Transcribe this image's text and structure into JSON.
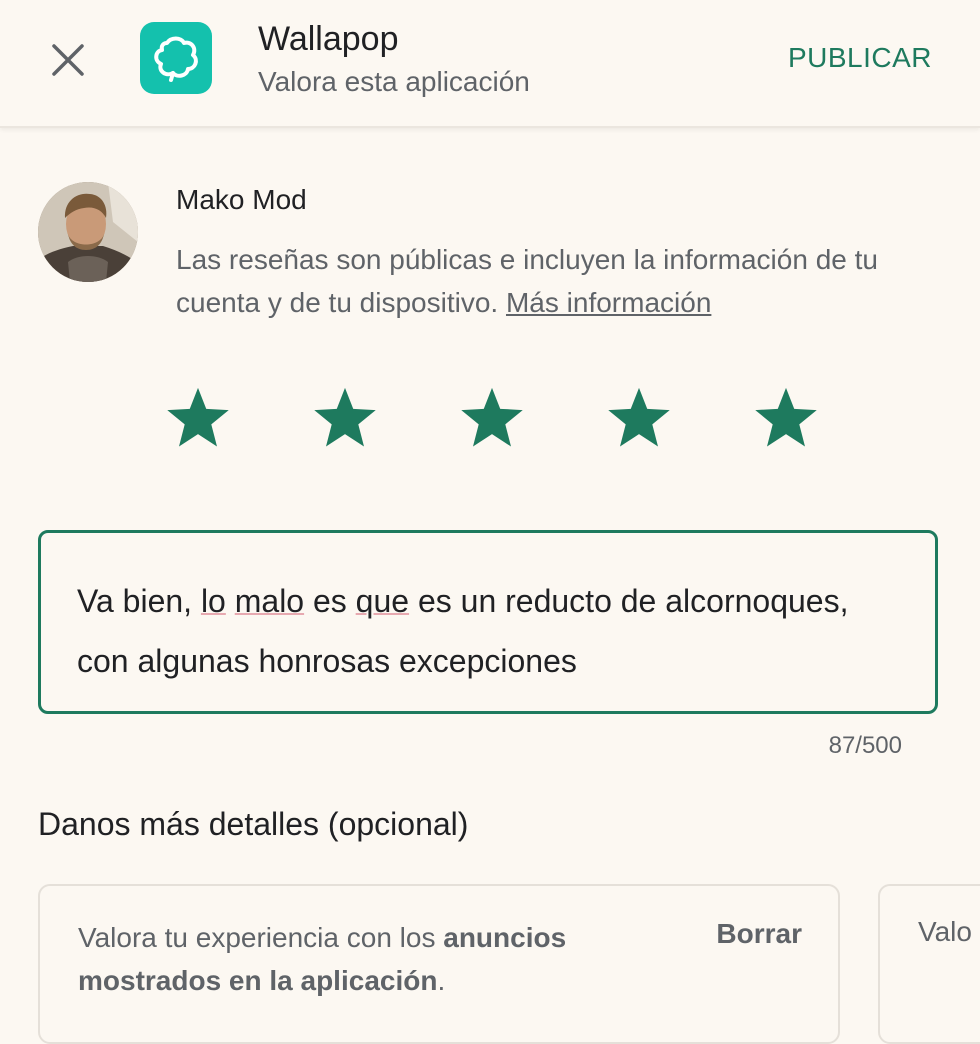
{
  "header": {
    "app_name": "Wallapop",
    "subtitle": "Valora esta aplicación",
    "publish_label": "PUBLICAR",
    "close_icon": "close-icon",
    "app_icon": "wallapop-logo-icon",
    "accent_color": "#1e7a5e",
    "app_icon_color": "#14c1ad"
  },
  "user": {
    "name": "Mako Mod",
    "disclaimer": "Las reseñas son públicas e incluyen la información de tu cuenta y de tu dispositivo.",
    "more_info_link": "Más información"
  },
  "rating": {
    "value": 5,
    "max": 5,
    "star_color": "#1e7a5e"
  },
  "review": {
    "text_parts": [
      "Va bien, ",
      "lo",
      " ",
      "malo",
      " es ",
      "que",
      " es un reducto de alcornoques, con algunas honrosas excepciones"
    ],
    "counter": "87/500"
  },
  "details": {
    "title": "Danos más detalles (opcional)",
    "cards": [
      {
        "text_before": "Valora tu experiencia con los ",
        "text_bold": "anuncios mostrados en la aplicación",
        "text_after": ".",
        "clear_label": "Borrar"
      },
      {
        "text_partial": "Valo"
      }
    ]
  }
}
